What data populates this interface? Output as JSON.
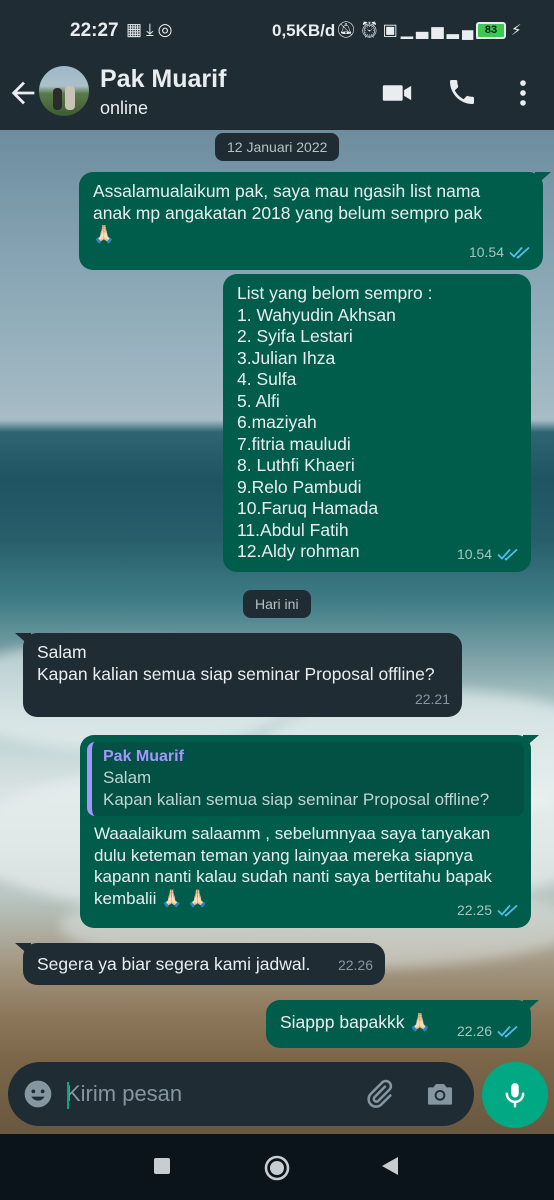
{
  "status_bar": {
    "time": "22:27",
    "left_icons": [
      "grid-icon",
      "download-icon",
      "chrome-icon"
    ],
    "net_speed": "0,5KB/d",
    "right_icons": [
      "mute-icon",
      "alarm-icon",
      "volte-icon",
      "signal-icon",
      "4g-icon",
      "signal-icon"
    ],
    "battery": "83"
  },
  "header": {
    "contact_name": "Pak Muarif",
    "contact_status": "online",
    "icons": [
      "back-arrow-icon",
      "video-call-icon",
      "phone-icon",
      "more-vert-icon"
    ]
  },
  "chat": {
    "date_chip_1": "12 Januari 2022",
    "date_chip_2": "Hari ini",
    "messages": [
      {
        "direction": "out",
        "lines": [
          "Assalamualaikum pak, saya mau ngasih list nama",
          "anak mp angakatan 2018 yang belum sempro pak",
          "🙏🏻"
        ],
        "time": "10.54",
        "status": "read"
      },
      {
        "direction": "out",
        "lines": [
          "List yang belom sempro :",
          "1. Wahyudin Akhsan",
          "2. Syifa Lestari",
          "3.Julian Ihza",
          "4. Sulfa",
          "5. Alfi",
          "6.maziyah",
          "7.fitria mauludi",
          "8. Luthfi Khaeri",
          "9.Relo Pambudi",
          "10.Faruq Hamada",
          "11.Abdul Fatih",
          "12.Aldy rohman"
        ],
        "time": "10.54",
        "status": "read"
      },
      {
        "direction": "in",
        "lines": [
          "Salam",
          "Kapan kalian semua siap seminar Proposal offline?"
        ],
        "time": "22.21"
      },
      {
        "direction": "out",
        "quote": {
          "author": "Pak Muarif",
          "lines": [
            "Salam",
            "Kapan kalian semua siap seminar Proposal offline?"
          ]
        },
        "lines": [
          "Waaalaikum salaamm , sebelumnyaa saya tanyakan",
          "dulu keteman teman yang lainyaa mereka siapnya",
          "kapann nanti kalau sudah nanti saya bertitahu bapak",
          "kembalii 🙏🏻 🙏🏻"
        ],
        "time": "22.25",
        "status": "read"
      },
      {
        "direction": "in",
        "lines": [
          "Segera ya biar segera kami jadwal."
        ],
        "time": "22.26"
      },
      {
        "direction": "out",
        "lines": [
          "Siappp bapakkk 🙏🏻"
        ],
        "time": "22.26",
        "status": "read"
      }
    ]
  },
  "composer": {
    "placeholder": "Kirim pesan",
    "icons": [
      "emoji-icon",
      "attach-icon",
      "camera-icon",
      "mic-icon"
    ]
  },
  "nav_bar": {
    "icons": [
      "recents-icon",
      "home-icon",
      "back-icon"
    ]
  },
  "colors": {
    "bar_bg": "#1f2c34",
    "outgoing_bubble": "#005c4b",
    "incoming_bubble": "#1f2c34",
    "accent": "#00a884",
    "read_ticks": "#53bdeb",
    "quote_author": "#a694ff"
  }
}
